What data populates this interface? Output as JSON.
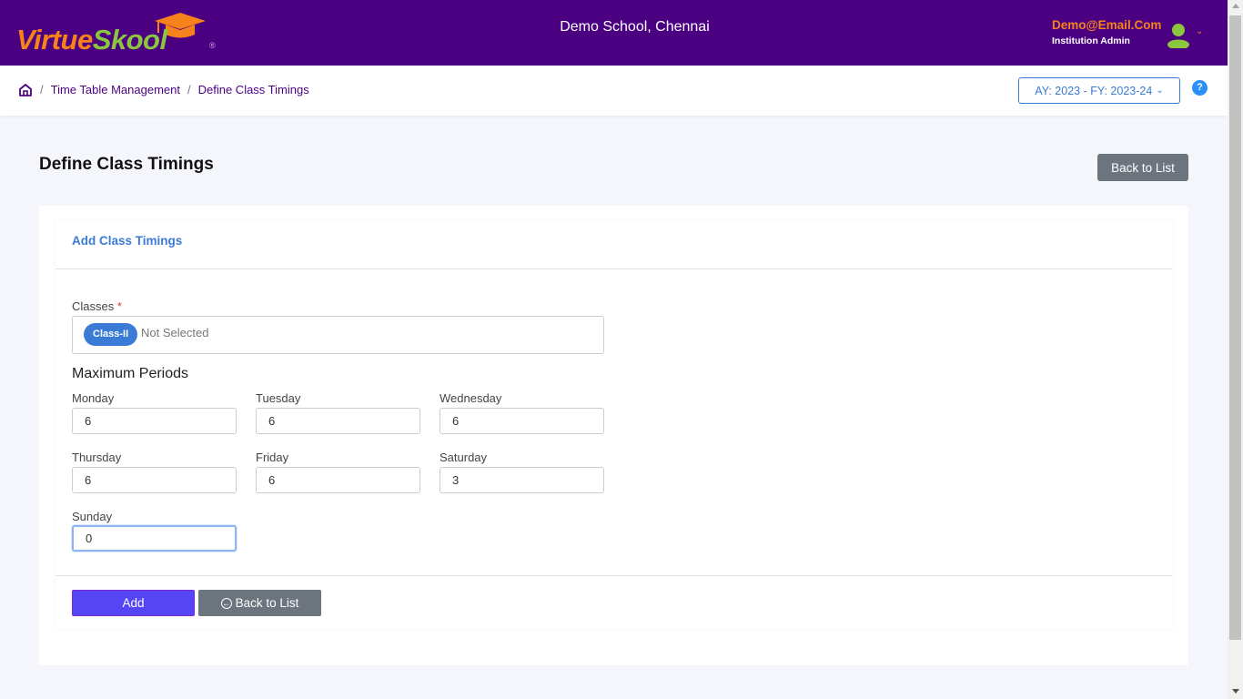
{
  "header": {
    "logo_part1": "Virtue",
    "logo_part2": "Skool",
    "logo_reg": "®",
    "school_name": "Demo School, Chennai",
    "user_email": "Demo@Email.Com",
    "user_role": "Institution Admin",
    "user_menu_caret": "⌄",
    "colors": {
      "bar": "#4b0082",
      "orange": "#f7821b",
      "green": "#8cc63f"
    }
  },
  "breadcrumb": {
    "home_icon": "home-icon",
    "separator": "/",
    "items": [
      "Time Table Management",
      "Define Class Timings"
    ]
  },
  "academic_year": {
    "selected": "AY: 2023 - FY: 2023-24",
    "caret": "⌄"
  },
  "help": {
    "label": "?"
  },
  "page": {
    "title": "Define Class Timings",
    "back_to_list": "Back to List"
  },
  "form": {
    "card_title": "Add Class Timings",
    "classes": {
      "label": "Classes",
      "required_mark": "*",
      "chips": [
        "Class-II"
      ],
      "placeholder": "Not Selected"
    },
    "max_periods_title": "Maximum Periods",
    "days": [
      {
        "label": "Monday",
        "value": "6"
      },
      {
        "label": "Tuesday",
        "value": "6"
      },
      {
        "label": "Wednesday",
        "value": "6"
      },
      {
        "label": "Thursday",
        "value": "6"
      },
      {
        "label": "Friday",
        "value": "6"
      },
      {
        "label": "Saturday",
        "value": "3"
      },
      {
        "label": "Sunday",
        "value": "0"
      }
    ],
    "add_button": "Add",
    "back_button": "Back to List",
    "back_icon": "←"
  }
}
